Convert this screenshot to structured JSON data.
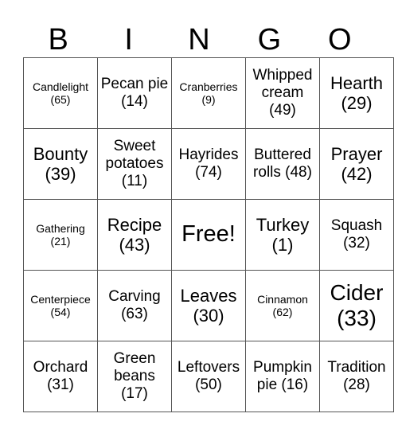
{
  "header": [
    "B",
    "I",
    "N",
    "G",
    "O"
  ],
  "rows": [
    [
      {
        "text": "Candlelight (65)",
        "size": "s1"
      },
      {
        "text": "Pecan pie (14)",
        "size": "s2"
      },
      {
        "text": "Cranberries (9)",
        "size": "s1"
      },
      {
        "text": "Whipped cream (49)",
        "size": "s2"
      },
      {
        "text": "Hearth (29)",
        "size": "s3"
      }
    ],
    [
      {
        "text": "Bounty (39)",
        "size": "s3"
      },
      {
        "text": "Sweet potatoes (11)",
        "size": "s2"
      },
      {
        "text": "Hayrides (74)",
        "size": "s2"
      },
      {
        "text": "Buttered rolls (48)",
        "size": "s2"
      },
      {
        "text": "Prayer (42)",
        "size": "s3"
      }
    ],
    [
      {
        "text": "Gathering (21)",
        "size": "s1"
      },
      {
        "text": "Recipe (43)",
        "size": "s3"
      },
      {
        "text": "Free!",
        "size": "free"
      },
      {
        "text": "Turkey (1)",
        "size": "s3"
      },
      {
        "text": "Squash (32)",
        "size": "s2"
      }
    ],
    [
      {
        "text": "Centerpiece (54)",
        "size": "s1"
      },
      {
        "text": "Carving (63)",
        "size": "s2"
      },
      {
        "text": "Leaves (30)",
        "size": "s3"
      },
      {
        "text": "Cinnamon (62)",
        "size": "s1"
      },
      {
        "text": "Cider (33)",
        "size": "s4"
      }
    ],
    [
      {
        "text": "Orchard (31)",
        "size": "s2"
      },
      {
        "text": "Green beans (17)",
        "size": "s2"
      },
      {
        "text": "Leftovers (50)",
        "size": "s2"
      },
      {
        "text": "Pumpkin pie (16)",
        "size": "s2"
      },
      {
        "text": "Tradition (28)",
        "size": "s2"
      }
    ]
  ]
}
